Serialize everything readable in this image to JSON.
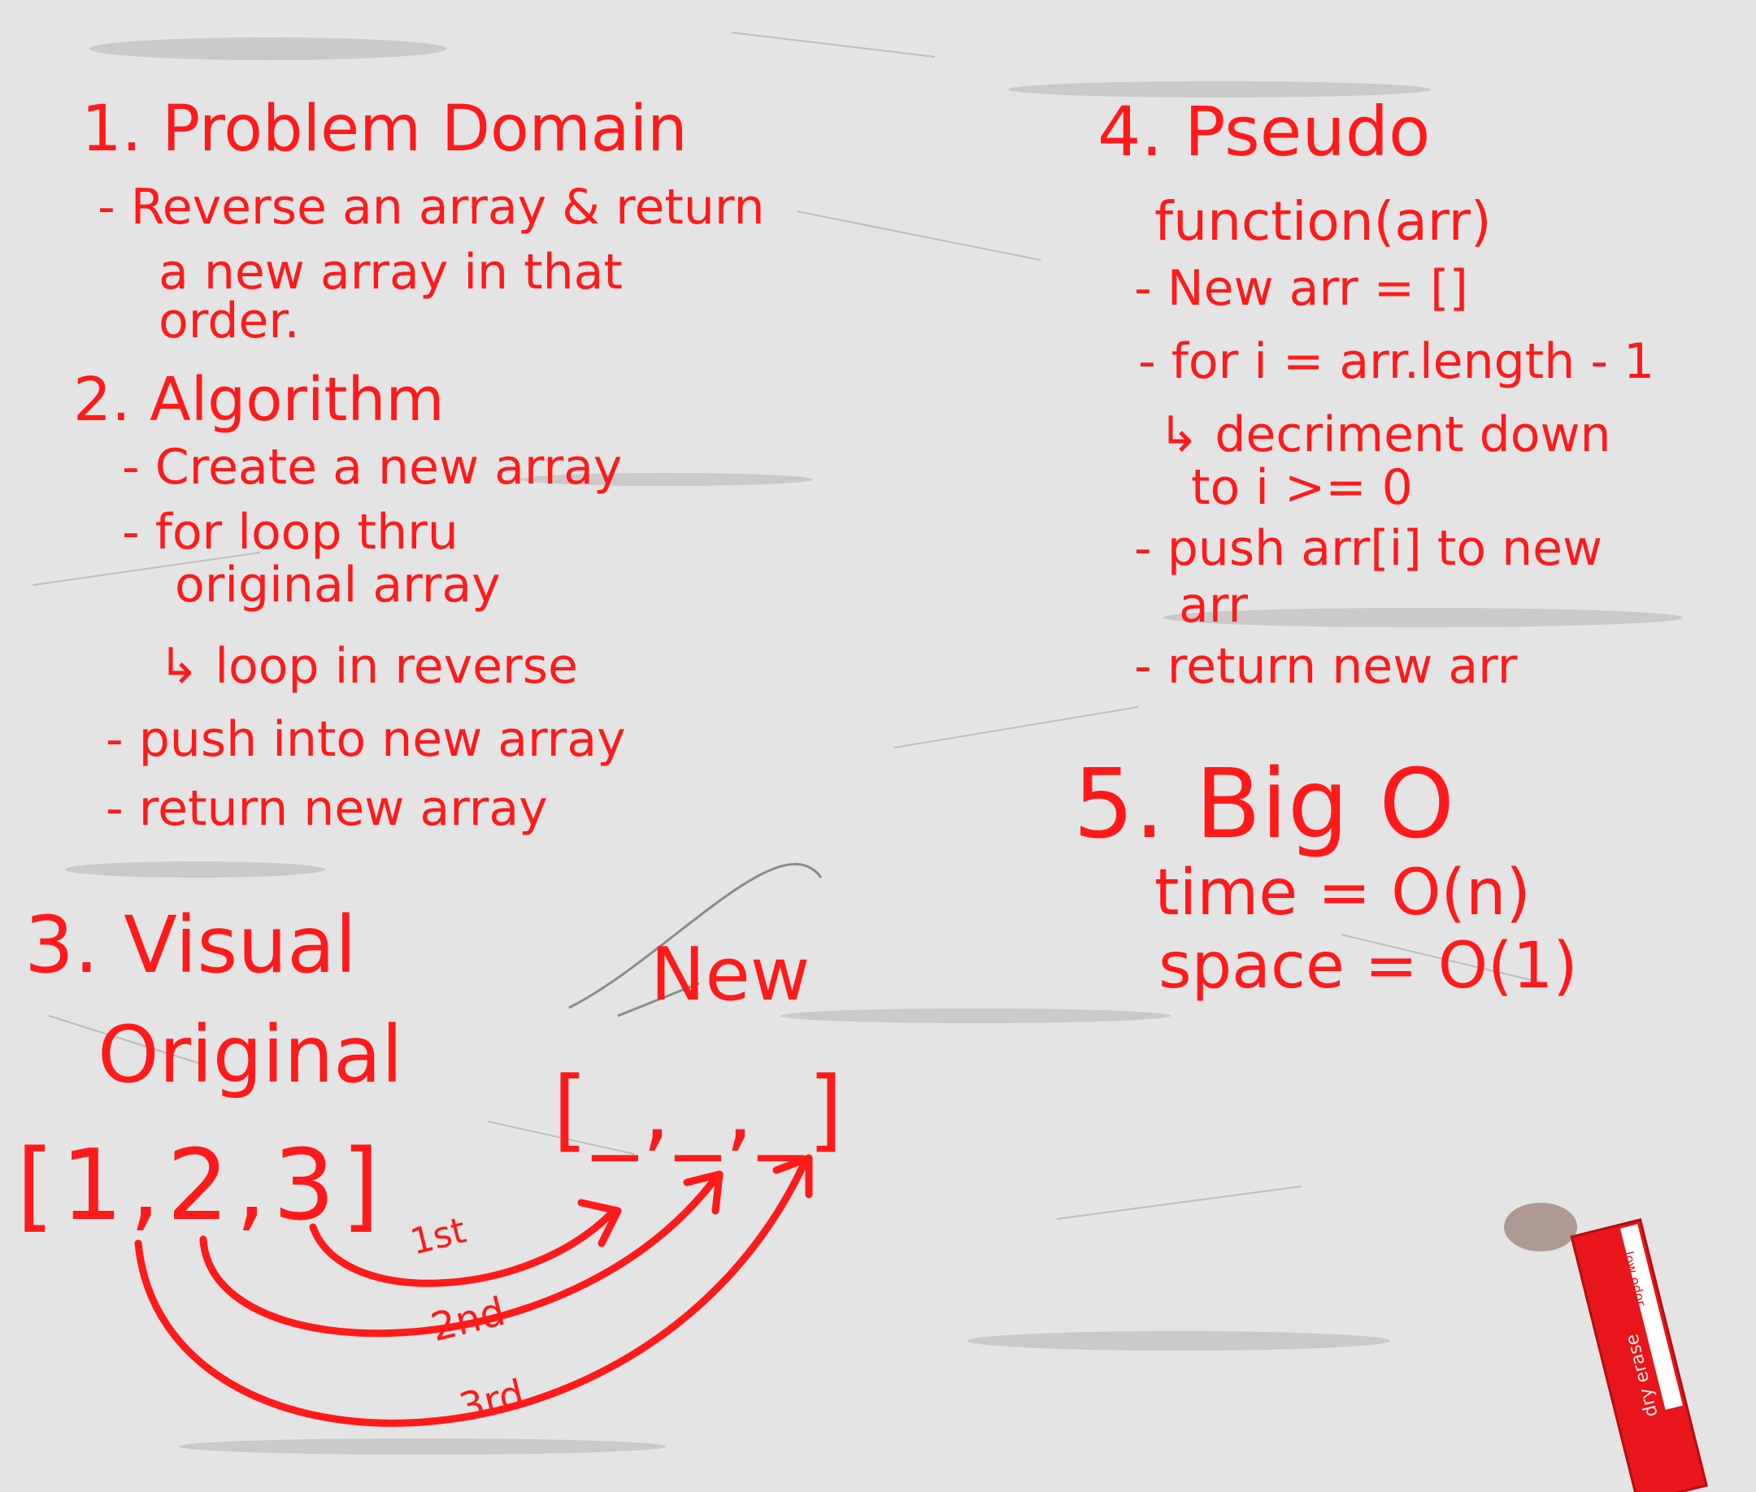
{
  "section1": {
    "heading": "1. Problem Domain",
    "lines": [
      "- Reverse an array & return",
      "a new array in that",
      "order."
    ]
  },
  "section2": {
    "heading": "2. Algorithm",
    "lines": [
      "- Create a new array",
      "- for loop thru",
      "original array",
      "↳ loop in reverse",
      "- push into new array",
      "- return new array"
    ]
  },
  "section3": {
    "heading": "3. Visual",
    "original_label": "Original",
    "new_label": "New",
    "original_array": "[1,2,3]",
    "new_array": "[_,_,_]",
    "order_labels": [
      "1st",
      "2nd",
      "3rd"
    ]
  },
  "section4": {
    "heading": "4. Pseudo",
    "lines": [
      "function(arr)",
      "- New arr = []",
      "- for i = arr.length - 1",
      "↳ decriment down",
      "to i >= 0",
      "- push arr[i] to new",
      "arr",
      "- return new arr"
    ]
  },
  "section5": {
    "heading": "5. Big O",
    "time": "time = O(n)",
    "space": "space = O(1)"
  },
  "marker": {
    "label": "dry erase",
    "brand": "low odor"
  },
  "colors": {
    "ink": "#ff1a1a",
    "board": "#e4e4e4",
    "marker": "#e8151b"
  }
}
